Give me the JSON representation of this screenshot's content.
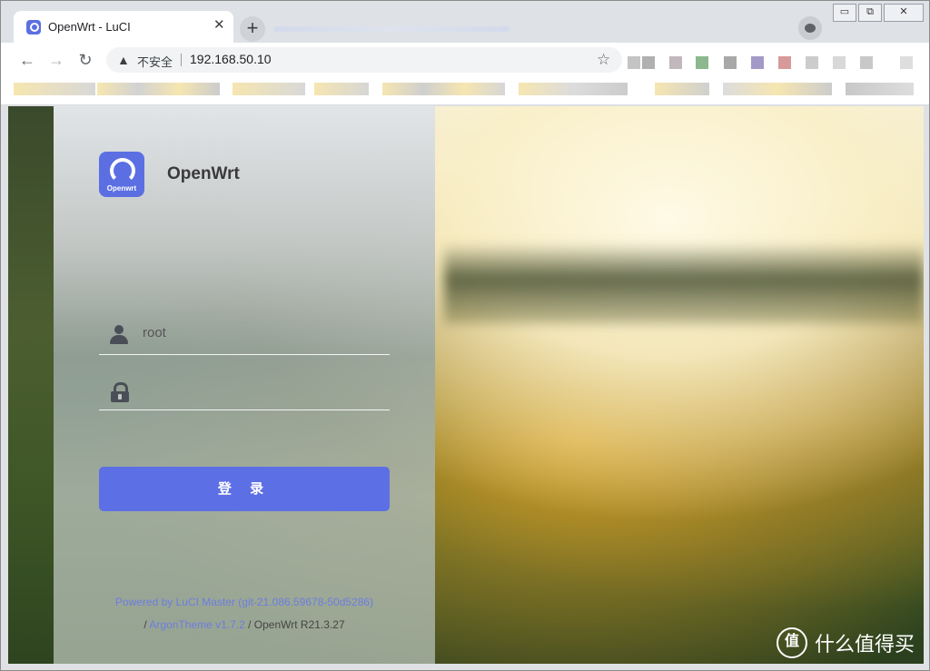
{
  "browser": {
    "tab_title": "OpenWrt - LuCI",
    "tab_close": "✕",
    "new_tab": "+",
    "security_label": "不安全",
    "url": "192.168.50.10",
    "window_controls": {
      "minimize": "▭",
      "restore": "⧉",
      "close": "✕"
    }
  },
  "login": {
    "brand": "OpenWrt",
    "logo_text": "Openwrt",
    "username_value": "root",
    "password_value": "",
    "submit_label": "登 录"
  },
  "footer": {
    "line1": "Powered by LuCI Master (git-21.086.59678-50d5286)",
    "slash1": "/",
    "theme_link": "ArgonTheme v1.7.2",
    "line2_rest": "/ OpenWrt R21.3.27"
  },
  "watermark": {
    "logo": "值",
    "text": "什么值得买"
  },
  "colors": {
    "accent": "#5d6fe4",
    "link": "#6b7de0"
  }
}
